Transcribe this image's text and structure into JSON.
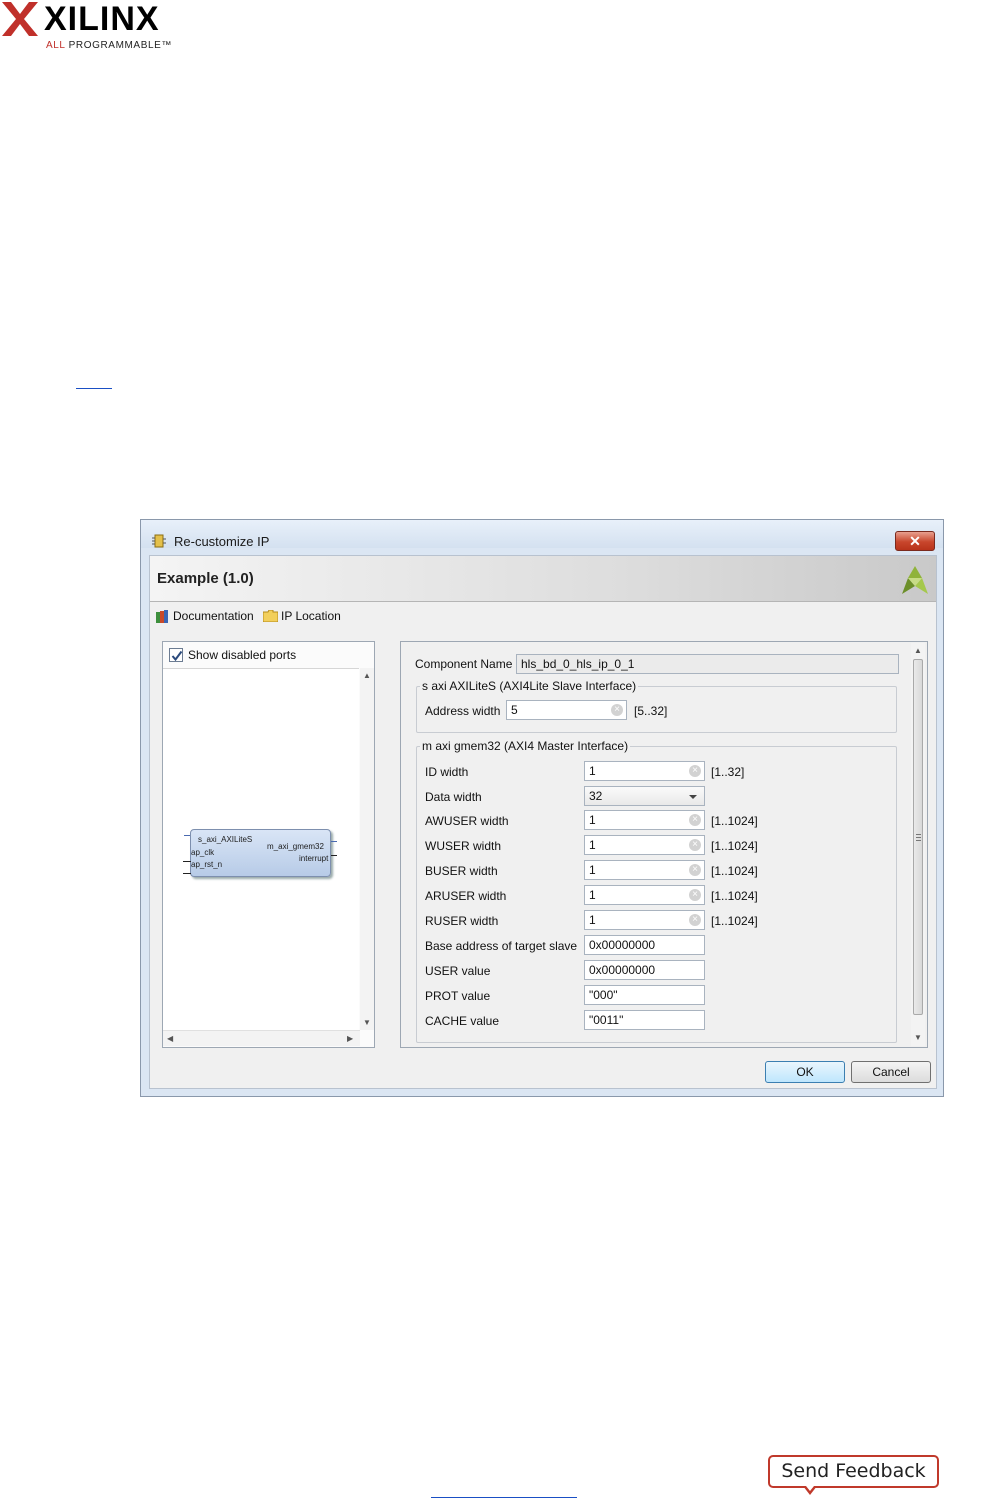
{
  "brand": {
    "name": "XILINX",
    "tagline_highlight": "ALL",
    "tagline_rest": "PROGRAMMABLE",
    "tagline_mark": "™"
  },
  "dialog": {
    "title": "Re-customize IP",
    "close_glyph": "✕",
    "header_title": "Example (1.0)",
    "toolbar": {
      "documentation_label": "Documentation",
      "ip_location_label": "IP Location"
    },
    "left_panel": {
      "show_disabled_ports_label": "Show disabled ports",
      "show_disabled_ports_checked": true,
      "block": {
        "port_s_axi": "s_axi_AXILiteS",
        "port_ap_clk": "ap_clk",
        "port_ap_rst_n": "ap_rst_n",
        "port_m_axi": "m_axi_gmem32",
        "port_interrupt": "interrupt"
      }
    },
    "right_panel": {
      "component_name_label": "Component Name",
      "component_name_value": "hls_bd_0_hls_ip_0_1",
      "s_axi_group_title": "s axi AXILiteS (AXI4Lite Slave Interface)",
      "address_width_label": "Address width",
      "address_width_value": "5",
      "address_width_range": "[5..32]",
      "m_axi_group_title": "m axi gmem32 (AXI4 Master Interface)",
      "fields": [
        {
          "label": "ID width",
          "value": "1",
          "range": "[1..32]"
        },
        {
          "label": "Data width",
          "value": "32",
          "range": ""
        },
        {
          "label": "AWUSER width",
          "value": "1",
          "range": "[1..1024]"
        },
        {
          "label": "WUSER width",
          "value": "1",
          "range": "[1..1024]"
        },
        {
          "label": "BUSER width",
          "value": "1",
          "range": "[1..1024]"
        },
        {
          "label": "ARUSER width",
          "value": "1",
          "range": "[1..1024]"
        },
        {
          "label": "RUSER width",
          "value": "1",
          "range": "[1..1024]"
        },
        {
          "label": "Base address of target slave",
          "value": "0x00000000",
          "range": ""
        },
        {
          "label": "USER value",
          "value": "0x00000000",
          "range": ""
        },
        {
          "label": "PROT value",
          "value": "\"000\"",
          "range": ""
        },
        {
          "label": "CACHE value",
          "value": "\"0011\"",
          "range": ""
        }
      ]
    },
    "buttons": {
      "ok": "OK",
      "cancel": "Cancel"
    }
  },
  "footer": {
    "send_feedback": "Send Feedback"
  },
  "colors": {
    "brand_red": "#c0302a",
    "titlebar": "#d4e1f0",
    "close_button": "#c8462c",
    "feedback_border": "#c0392b"
  },
  "icons": [
    "xilinx-logo-icon",
    "ip-chip-icon",
    "close-icon",
    "vivado-logo-icon",
    "documentation-books-icon",
    "folder-icon",
    "checkbox-check-icon",
    "clear-field-icon",
    "dropdown-arrow-icon"
  ]
}
